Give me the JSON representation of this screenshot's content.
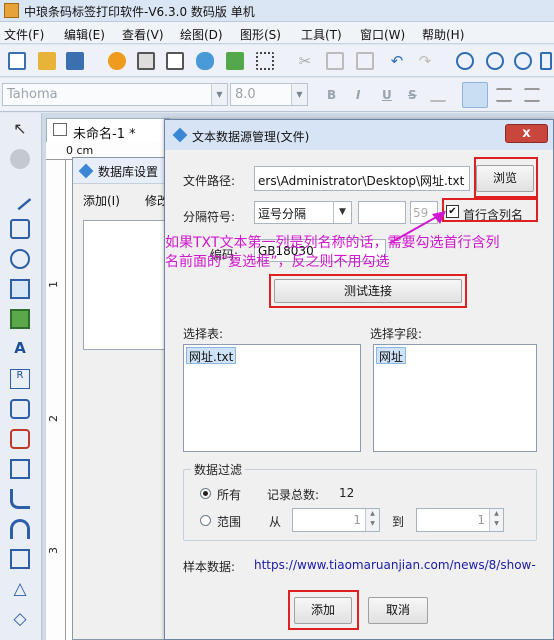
{
  "app": {
    "title": "中琅条码标签打印软件-V6.3.0 数码版 单机"
  },
  "menu": [
    "文件(F)",
    "编辑(E)",
    "查看(V)",
    "绘图(D)",
    "图形(S)",
    "工具(T)",
    "窗口(W)",
    "帮助(H)"
  ],
  "format": {
    "font": "Tahoma",
    "size": "8.0",
    "bold": "B",
    "italic": "I",
    "underline": "U",
    "strike": "S"
  },
  "doc": {
    "tab_title": "未命名-1 *",
    "ruler_unit": "0 cm",
    "ruler_marks": [
      "1",
      "2",
      "3"
    ]
  },
  "db_window": {
    "title": "数据库设置",
    "menu_add": "添加(I)",
    "menu_edit": "修改"
  },
  "dialog": {
    "title": "文本数据源管理(文件)",
    "close": "x",
    "file_path_label": "文件路径:",
    "file_path_value": "ers\\Administrator\\Desktop\\网址.txt",
    "browse": "浏览",
    "separator_label": "分隔符号:",
    "separator_value": "逗号分隔",
    "separator_num": "59",
    "first_row_label": "首行含列名",
    "first_row_checked": "✔",
    "encoding_label": "编码:",
    "encoding_value": "GB18030",
    "test_button": "测试连接",
    "select_table_label": "选择表:",
    "tables": [
      "网址.txt"
    ],
    "select_field_label": "选择字段:",
    "fields": [
      "网址"
    ],
    "filter_legend": "数据过滤",
    "all_label": "所有",
    "record_total_label": "记录总数:",
    "record_total": "12",
    "range_label": "范围",
    "from_label": "从",
    "from_value": "1",
    "to_label": "到",
    "to_value": "1",
    "sample_label": "样本数据:",
    "sample_value": "https://www.tiaomaruanjian.com/news/8/show-",
    "add_button": "添加",
    "cancel_button": "取消"
  },
  "annotation": {
    "line1": "如果TXT文本第一列是列名称的话，需要勾选首行含列",
    "line2": "名前面的“复选框”，反之则不用勾选"
  },
  "colors": {
    "highlight": "#e02020",
    "annotation": "#d118cf",
    "link": "#1a1aa8"
  }
}
